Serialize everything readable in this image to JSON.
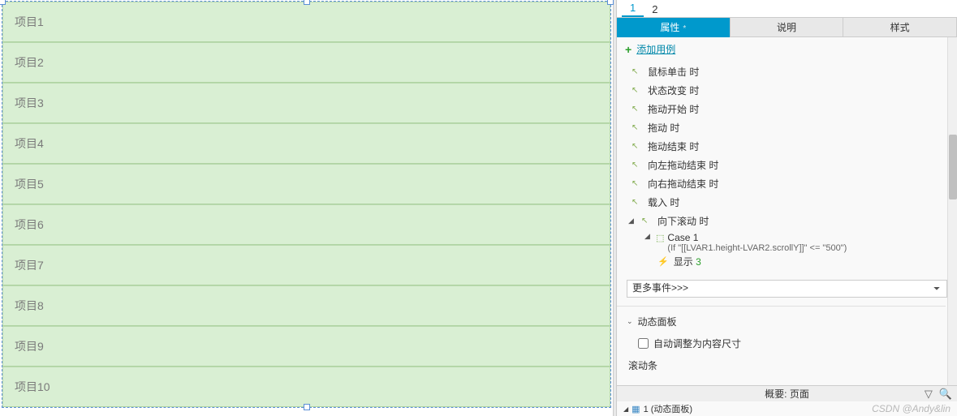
{
  "canvas": {
    "items": [
      "项目1",
      "项目2",
      "项目3",
      "项目4",
      "项目5",
      "项目6",
      "项目7",
      "项目8",
      "项目9",
      "项目10"
    ]
  },
  "topTabs": {
    "tab1": "1",
    "tab2": "2"
  },
  "tabs": {
    "properties": "属性",
    "notes": "说明",
    "style": "样式"
  },
  "addCase": "添加用例",
  "events": {
    "click": "鼠标单击 时",
    "stateChange": "状态改变 时",
    "dragStart": "拖动开始 时",
    "drag": "拖动 时",
    "dragEnd": "拖动结束 时",
    "swipeLeft": "向左拖动结束 时",
    "swipeRight": "向右拖动结束 时",
    "load": "载入 时",
    "scrollDown": "向下滚动 时"
  },
  "case1": {
    "name": "Case 1",
    "condition": "(If \"[[LVAR1.height-LVAR2.scrollY]]\" <= \"500\")",
    "actionLabel": "显示",
    "actionTarget": "3"
  },
  "moreEvents": "更多事件>>>",
  "dynamicPanel": {
    "title": "动态面板",
    "autoFit": "自动调整为内容尺寸",
    "scrollbar": "滚动条"
  },
  "outline": {
    "title": "概要: 页面",
    "node": "1 (动态面板)"
  },
  "watermark": "CSDN @Andy&lin"
}
